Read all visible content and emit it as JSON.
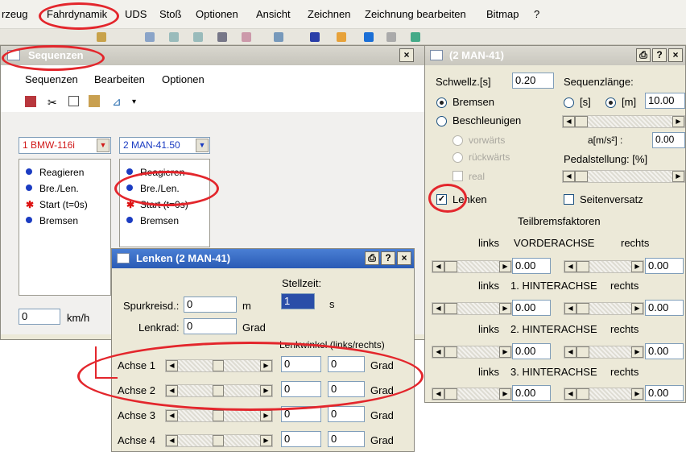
{
  "menubar": {
    "items": [
      "rzeug",
      "Fahrdynamik",
      "UDS",
      "Stoß",
      "Optionen",
      "Ansicht",
      "Zeichnen",
      "Zeichnung bearbeiten",
      "Bitmap",
      "?"
    ]
  },
  "sequenzen": {
    "title": "Sequenzen",
    "close": "×",
    "menu": [
      "Sequenzen",
      "Bearbeiten",
      "Optionen"
    ],
    "toolbar_icons": [
      "cut-icon",
      "scissors-icon",
      "copy-icon",
      "paste-icon",
      "chart-icon",
      "dropdown-icon"
    ],
    "vehicle1": {
      "label": "1  BMW-116i",
      "color": "#d11a1a",
      "items": [
        {
          "text": "Reagieren",
          "icon": "dot"
        },
        {
          "text": "Bre./Len.",
          "icon": "dot"
        },
        {
          "text": "Start (t=0s)",
          "icon": "star"
        },
        {
          "text": "Bremsen",
          "icon": "dot"
        }
      ]
    },
    "vehicle2": {
      "label": "2  MAN-41.50",
      "color": "#1b3cc2",
      "items": [
        {
          "text": "Reagieren",
          "icon": "dot"
        },
        {
          "text": "Bre./Len.",
          "icon": "dot"
        },
        {
          "text": "Start (t=0s)",
          "icon": "star"
        },
        {
          "text": "Bremsen",
          "icon": "dot"
        }
      ]
    },
    "speed": {
      "value": "0",
      "unit": "km/h"
    }
  },
  "man": {
    "title": "(2  MAN-41)",
    "buttons": [
      "⎙",
      "?",
      "×"
    ],
    "schwelle_label": "Schwellz.[s]",
    "schwelle_value": "0.20",
    "seqlen_label": "Sequenzlänge:",
    "bremsen": "Bremsen",
    "beschleunigen": "Beschleunigen",
    "unit_s": "[s]",
    "unit_m": "[m]",
    "seqlen_value": "10.00",
    "vorwaerts": "vorwärts",
    "rueckwaerts": "rückwärts",
    "real": "real",
    "accel_label": "a[m/s²] :",
    "accel_value": "0.00",
    "pedal_label": "Pedalstellung: [%]",
    "lenken": "Lenken",
    "lenken_checked": "✓",
    "seitenversatz": "Seitenversatz",
    "teilbrems": "Teilbremsfaktoren",
    "axles": [
      {
        "left": "links",
        "name": "VORDERACHSE",
        "right": "rechts",
        "lval": "0.00",
        "rval": "0.00"
      },
      {
        "left": "links",
        "name": "1. HINTERACHSE",
        "right": "rechts",
        "lval": "0.00",
        "rval": "0.00"
      },
      {
        "left": "links",
        "name": "2. HINTERACHSE",
        "right": "rechts",
        "lval": "0.00",
        "rval": "0.00"
      },
      {
        "left": "links",
        "name": "3. HINTERACHSE",
        "right": "rechts",
        "lval": "0.00",
        "rval": "0.00"
      }
    ]
  },
  "lenken": {
    "title": "Lenken (2  MAN-41)",
    "buttons": [
      "⎙",
      "?",
      "×"
    ],
    "stellzeit_label": "Stellzeit:",
    "stellzeit_value": "1",
    "stellzeit_unit": "s",
    "spurkreis_label": "Spurkreisd.:",
    "spurkreis_value": "0",
    "spurkreis_unit": "m",
    "lenkrad_label": "Lenkrad:",
    "lenkrad_value": "0",
    "lenkrad_unit": "Grad",
    "lenkwinkel_label": "Lenkwinkel (links/rechts)",
    "achsen": [
      {
        "label": "Achse 1",
        "l": "0",
        "r": "0",
        "unit": "Grad"
      },
      {
        "label": "Achse 2",
        "l": "0",
        "r": "0",
        "unit": "Grad"
      },
      {
        "label": "Achse 3",
        "l": "0",
        "r": "0",
        "unit": "Grad"
      },
      {
        "label": "Achse 4",
        "l": "0",
        "r": "0",
        "unit": "Grad"
      }
    ]
  },
  "colors": {
    "highlight": "#e3262c",
    "titlebar_active": "#2a5bb5"
  }
}
